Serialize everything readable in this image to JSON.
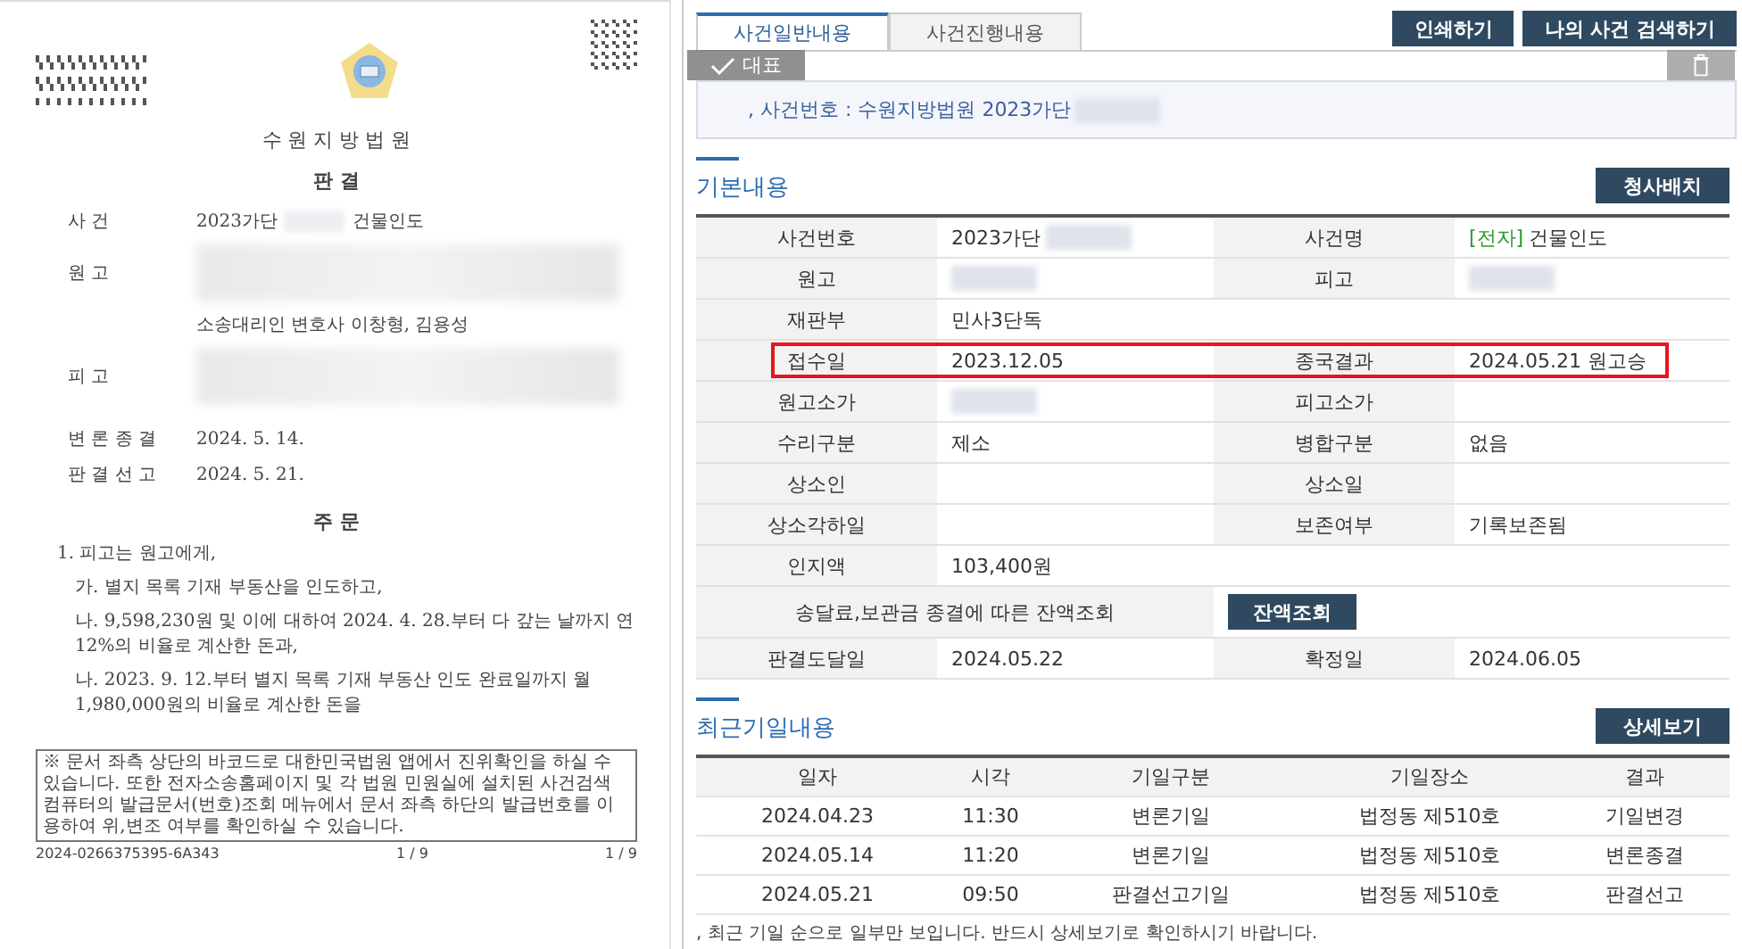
{
  "document": {
    "court": "수 원 지 방 법 원",
    "doc_type": "판 결",
    "parties": [
      {
        "label": "사 건",
        "value": "2023가단",
        "redacted": true,
        "extra": "건물인도"
      },
      {
        "label": "원 고",
        "redacted": true
      },
      {
        "value": "소송대리인 변호사 이창형, 김용성"
      },
      {
        "label": "피 고",
        "redacted": true
      }
    ],
    "dates": [
      {
        "label": "변 론 종 결",
        "value": "2024. 5. 14."
      },
      {
        "label": "판 결 선 고",
        "value": "2024. 5. 21."
      }
    ],
    "order_title": "주 문",
    "order": [
      {
        "text": "1. 피고는 원고에게,",
        "children": [
          {
            "text": "가. 별지 목록 기재 부동산을 인도하고,"
          },
          {
            "text": "나. 9,598,230원 및 이에 대하여 2024. 4. 28.부터 다 갚는 날까지 연 12%의 비율로 계산한 돈과,"
          },
          {
            "text": "나. 2023. 9. 12.부터 별지 목록 기재 부동산 인도 완료일까지 월 1,980,000원의 비율로 계산한 돈을"
          }
        ]
      }
    ],
    "notice": "※ 문서 좌측 상단의 바코드로 대한민국법원 앱에서 진위확인을 하실 수 있습니다. 또한 전자소송홈페이지 및 각 법원 민원실에 설치된 사건검색 컴퓨터의 발급문서(번호)조회 메뉴에서 문서 좌측 하단의 발급번호를 이용하여 위,변조 여부를 확인하실 수 있습니다.",
    "issue_number": "2024-0266375395-6A343",
    "page_center": "1 / 9",
    "page_right": "1 / 9"
  },
  "case_page": {
    "tabs": [
      {
        "label": "사건일반내용",
        "selected": true
      },
      {
        "label": "사건진행내용",
        "selected": false
      }
    ],
    "buttons": [
      "인쇄하기",
      "나의 사건 검색하기"
    ],
    "overlay": {
      "label": "대표",
      "checked": true
    },
    "case_number": {
      "text": ", 사건번호 : 수원지방법원 2023가단",
      "redacted": true
    },
    "basic": {
      "title": "기본내용",
      "button": "청사배치",
      "rows": [
        {
          "cells": [
            {
              "label": "사건번호",
              "value": "2023가단",
              "redacted": true
            },
            {
              "label": "사건명",
              "tag": "[전자]",
              "value": "건물인도"
            }
          ]
        },
        {
          "cells": [
            {
              "label": "원고",
              "redacted": true
            },
            {
              "label": "피고",
              "redacted": true
            }
          ]
        },
        {
          "cells": [
            {
              "label": "재판부",
              "value": "민사3단독"
            }
          ]
        },
        {
          "highlighted": true,
          "cells": [
            {
              "label": "접수일",
              "value": "2023.12.05"
            },
            {
              "label": "종국결과",
              "value": "2024.05.21 원고승"
            }
          ]
        },
        {
          "cells": [
            {
              "label": "원고소가",
              "redacted": true
            },
            {
              "label": "피고소가"
            }
          ]
        },
        {
          "cells": [
            {
              "label": "수리구분",
              "value": "제소"
            },
            {
              "label": "병합구분",
              "value": "없음"
            }
          ]
        },
        {
          "cells": [
            {
              "label": "상소인"
            },
            {
              "label": "상소일"
            }
          ]
        },
        {
          "cells": [
            {
              "label": "상소각하일"
            },
            {
              "label": "보존여부",
              "value": "기록보존됨"
            }
          ]
        },
        {
          "cells": [
            {
              "label": "인지액",
              "value": "103,400원"
            }
          ]
        },
        {
          "kind": "lookup",
          "label": "송달료,보관금 종결에 따른 잔액조회",
          "button": "잔액조회"
        },
        {
          "cells": [
            {
              "label": "판결도달일",
              "value": "2024.05.22"
            },
            {
              "label": "확정일",
              "value": "2024.06.05"
            }
          ]
        }
      ]
    },
    "hearings": {
      "title": "최근기일내용",
      "button": "상세보기",
      "columns": [
        "일자",
        "시각",
        "기일구분",
        "기일장소",
        "결과"
      ],
      "rows": [
        [
          "2024.04.23",
          "11:30",
          "변론기일",
          "법정동 제510호",
          "기일변경"
        ],
        [
          "2024.05.14",
          "11:20",
          "변론기일",
          "법정동 제510호",
          "변론종결"
        ],
        [
          "2024.05.21",
          "09:50",
          "판결선고기일",
          "법정동 제510호",
          "판결선고"
        ]
      ],
      "note": ", 최근 기일 순으로 일부만 보입니다. 반드시 상세보기로 확인하시기 바랍니다."
    }
  }
}
